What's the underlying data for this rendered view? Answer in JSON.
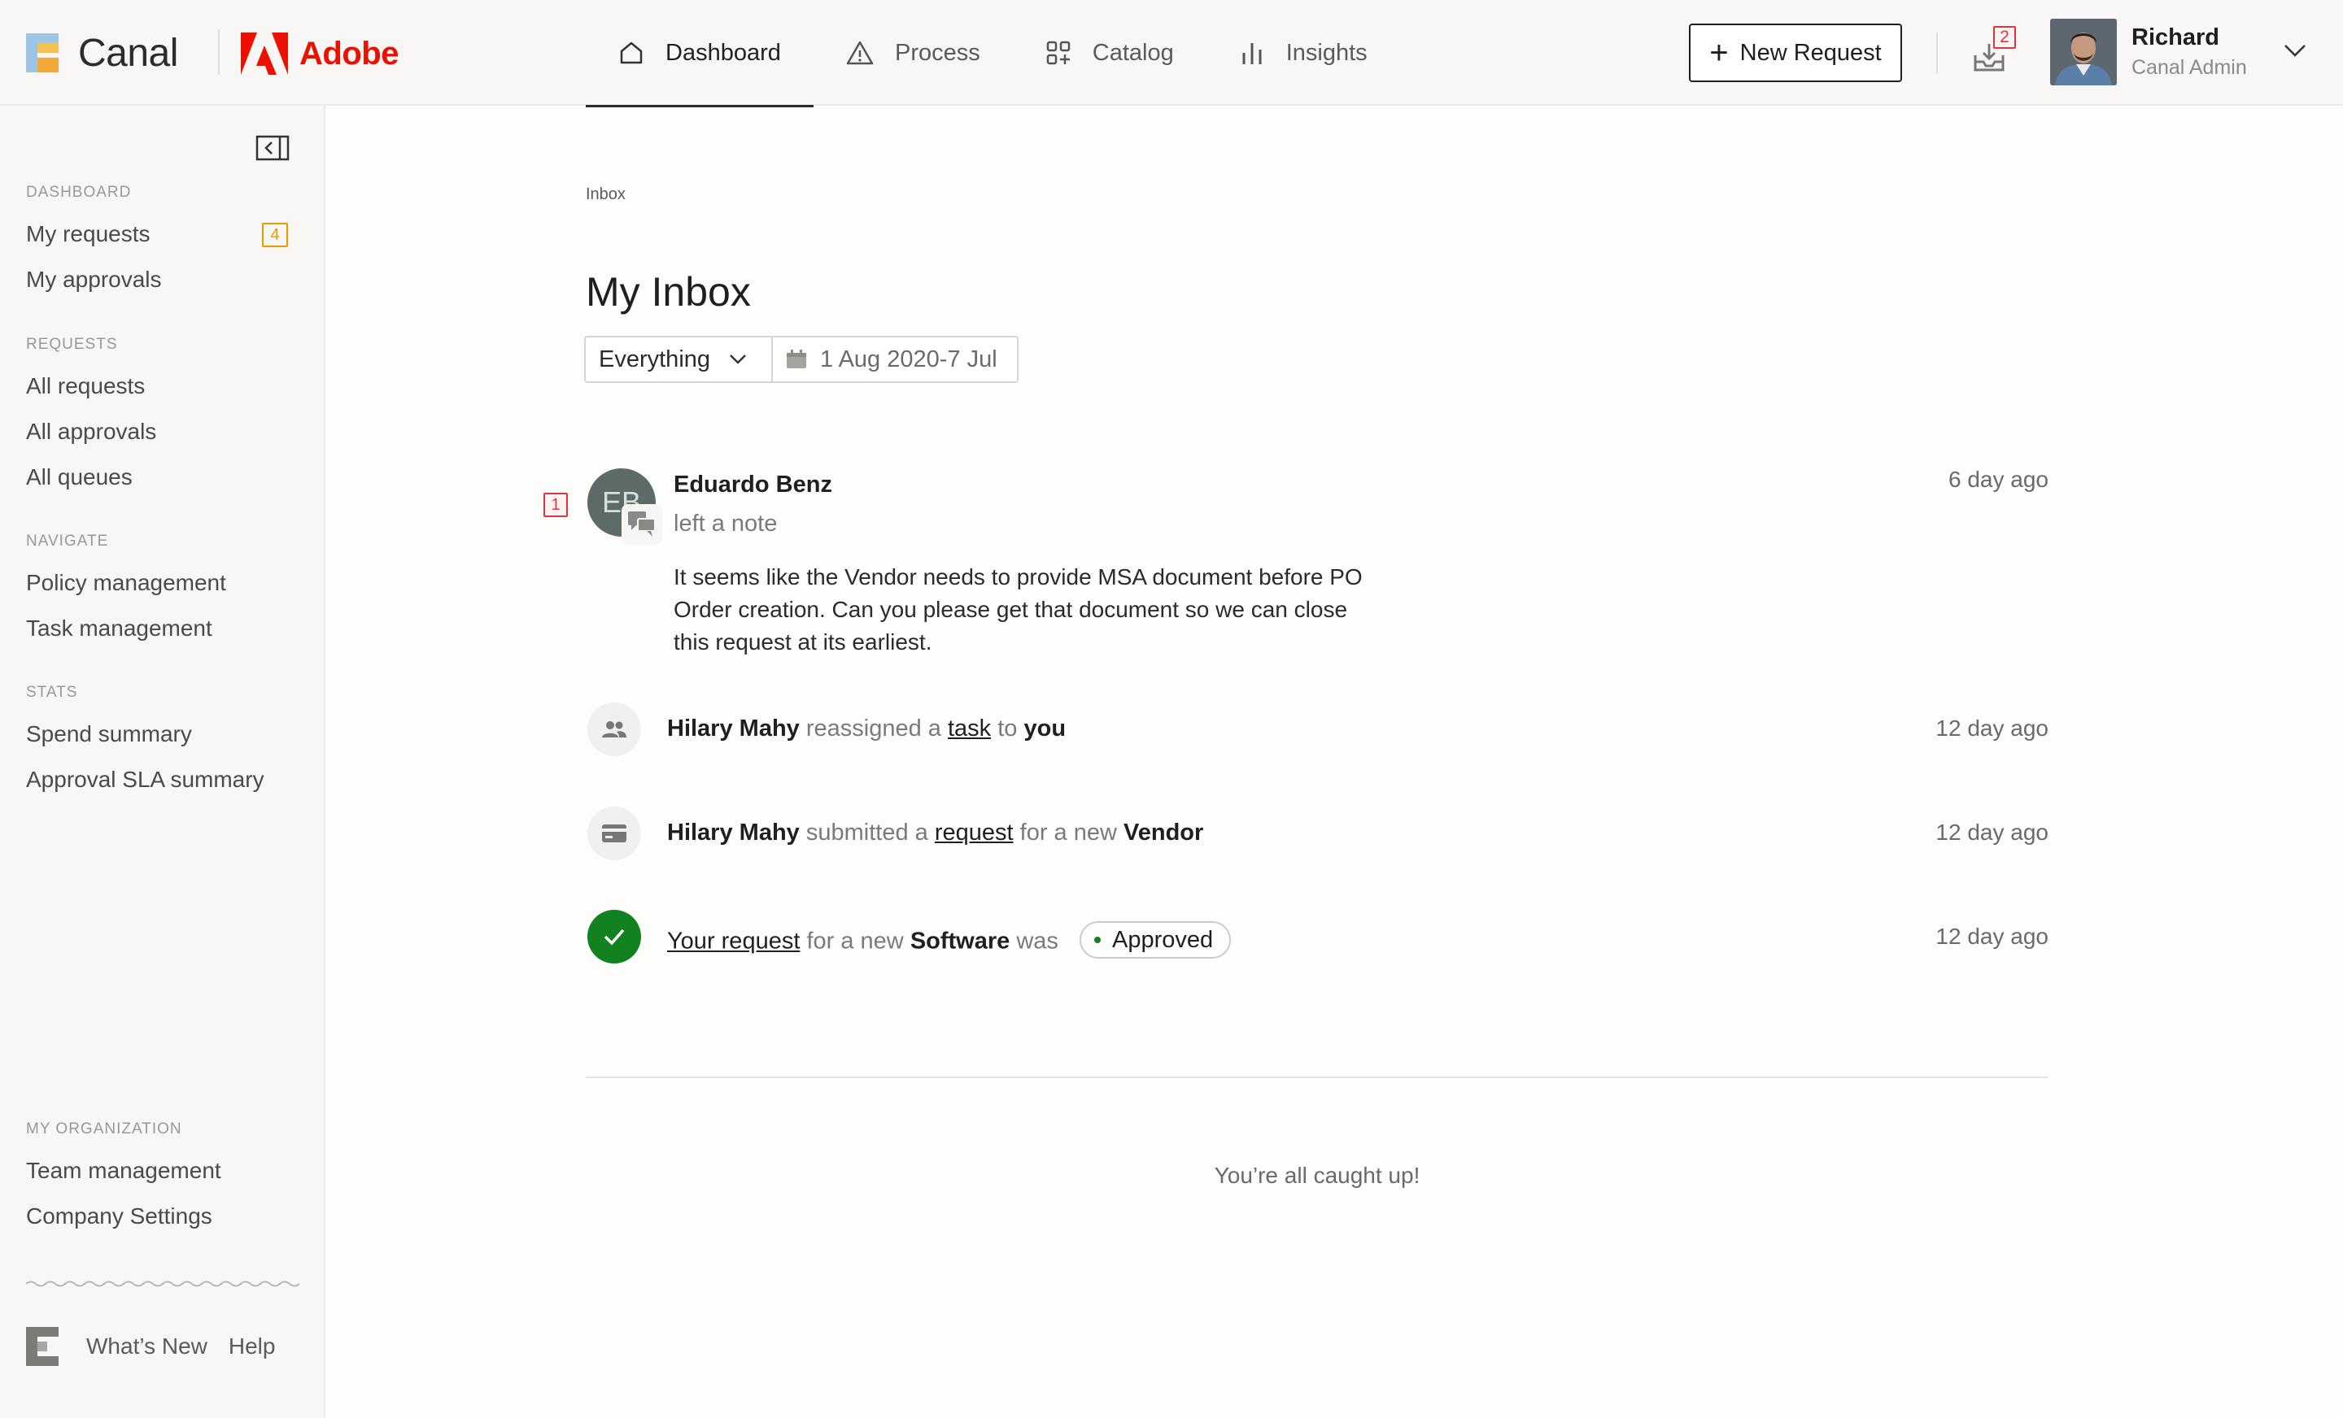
{
  "brand": {
    "name": "Canal",
    "partner": "Adobe",
    "partner_color": "#eb1000"
  },
  "nav": {
    "items": [
      {
        "label": "Dashboard",
        "icon": "home-icon",
        "active": true
      },
      {
        "label": "Process",
        "icon": "warning-icon",
        "active": false
      },
      {
        "label": "Catalog",
        "icon": "grid-plus-icon",
        "active": false
      },
      {
        "label": "Insights",
        "icon": "bar-chart-icon",
        "active": false
      }
    ]
  },
  "header": {
    "new_request_label": "New Request",
    "inbox_count": "2",
    "user": {
      "name": "Richard",
      "role": "Canal Admin"
    }
  },
  "sidebar": {
    "sections": [
      {
        "head": "DASHBOARD",
        "items": [
          {
            "label": "My requests",
            "count": "4"
          },
          {
            "label": "My approvals"
          }
        ]
      },
      {
        "head": "REQUESTS",
        "items": [
          {
            "label": "All requests"
          },
          {
            "label": "All approvals"
          },
          {
            "label": "All queues"
          }
        ]
      },
      {
        "head": "NAVIGATE",
        "items": [
          {
            "label": "Policy management"
          },
          {
            "label": "Task management"
          }
        ]
      },
      {
        "head": "STATS",
        "items": [
          {
            "label": "Spend summary"
          },
          {
            "label": "Approval SLA summary"
          }
        ]
      },
      {
        "head": "MY ORGANIZATION",
        "items": [
          {
            "label": "Team management"
          },
          {
            "label": "Company Settings"
          }
        ]
      }
    ],
    "footer": {
      "whats_new": "What’s New",
      "help": "Help"
    }
  },
  "main": {
    "breadcrumb": "Inbox",
    "title": "My Inbox",
    "filter": {
      "selected": "Everything",
      "date_range": "1 Aug 2020-7 Jul"
    },
    "feed": {
      "note": {
        "badge": "1",
        "initials": "EB",
        "author": "Eduardo Benz",
        "action": "left a note",
        "body": "It seems like the Vendor needs to provide MSA document before PO Order creation. Can you please get that document so we can close this request at its earliest.",
        "time": "6 day ago"
      },
      "reassign": {
        "actor": "Hilary Mahy",
        "t1": "reassigned a",
        "link": "task",
        "t2": "to",
        "target": "you",
        "time": "12 day ago"
      },
      "submit": {
        "actor": "Hilary Mahy",
        "t1": "submitted a",
        "link": "request",
        "t2": "for a new",
        "target": "Vendor",
        "time": "12 day ago"
      },
      "approved": {
        "link": "Your request",
        "t1": "for a new",
        "target": "Software",
        "t2": "was",
        "status": "Approved",
        "status_color": "#12811f",
        "time": "12 day ago"
      }
    },
    "caught_up": "You’re all caught up!"
  }
}
